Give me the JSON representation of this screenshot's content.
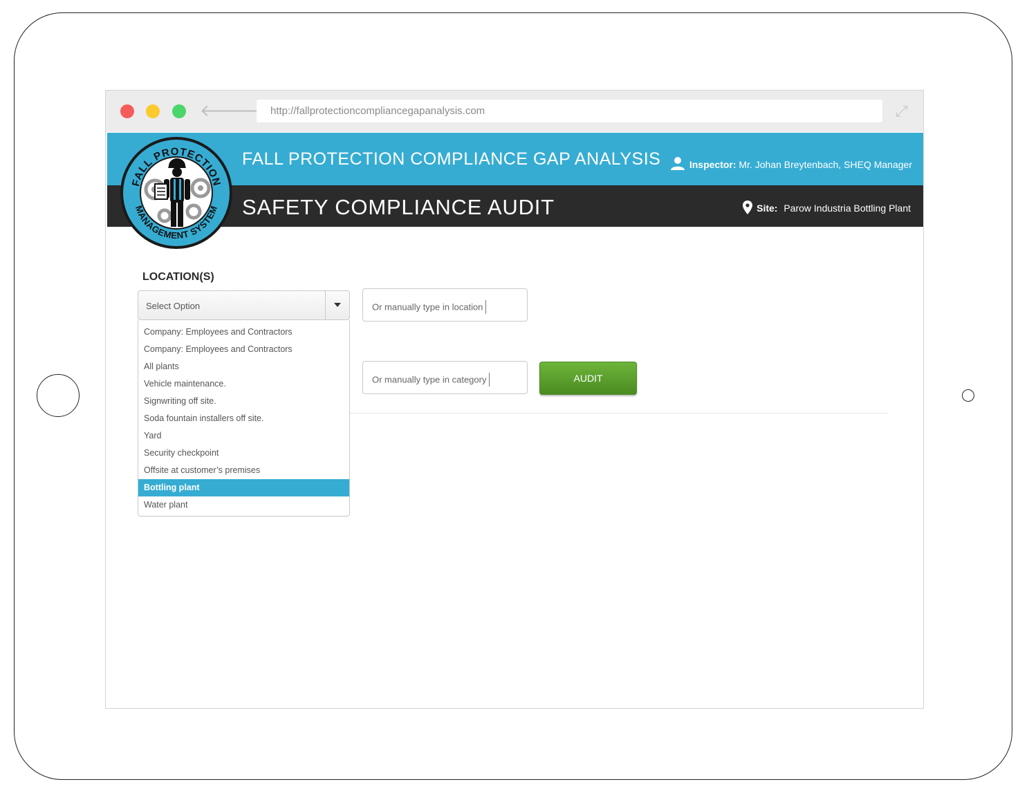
{
  "browser": {
    "url": "http://fallprotectioncompliancegapanalysis.com"
  },
  "header": {
    "app_title": "FALL PROTECTION COMPLIANCE GAP ANALYSIS",
    "inspector_label": "Inspector:",
    "inspector_name": "Mr. Johan Breytenbach, SHEQ Manager",
    "page_title": "SAFETY COMPLIANCE AUDIT",
    "site_label": "Site:",
    "site_name": "Parow Industria Bottling Plant"
  },
  "logo": {
    "top_text": "FALL PROTECTION",
    "bottom_text": "MANAGEMENT SYSTEM"
  },
  "form": {
    "location_label": "LOCATION(S)",
    "select_value": "Select Option",
    "location_placeholder": "Or manually type in location",
    "category_placeholder": "Or manually type in category",
    "audit_label": "AUDIT",
    "location_options": [
      "Company: Employees and Contractors",
      "Company: Employees and Contractors",
      "All plants",
      "Vehicle maintenance.",
      "Signwriting off site.",
      "Soda fountain installers off site.",
      "Yard",
      "Security checkpoint",
      "Offsite at customer’s premises",
      "Bottling plant",
      "Water plant"
    ],
    "selected_option": "Bottling plant"
  },
  "colors": {
    "accent_blue": "#36acd3",
    "dark_bar": "#2b2b2b",
    "audit_green": "#5a9e2e"
  }
}
